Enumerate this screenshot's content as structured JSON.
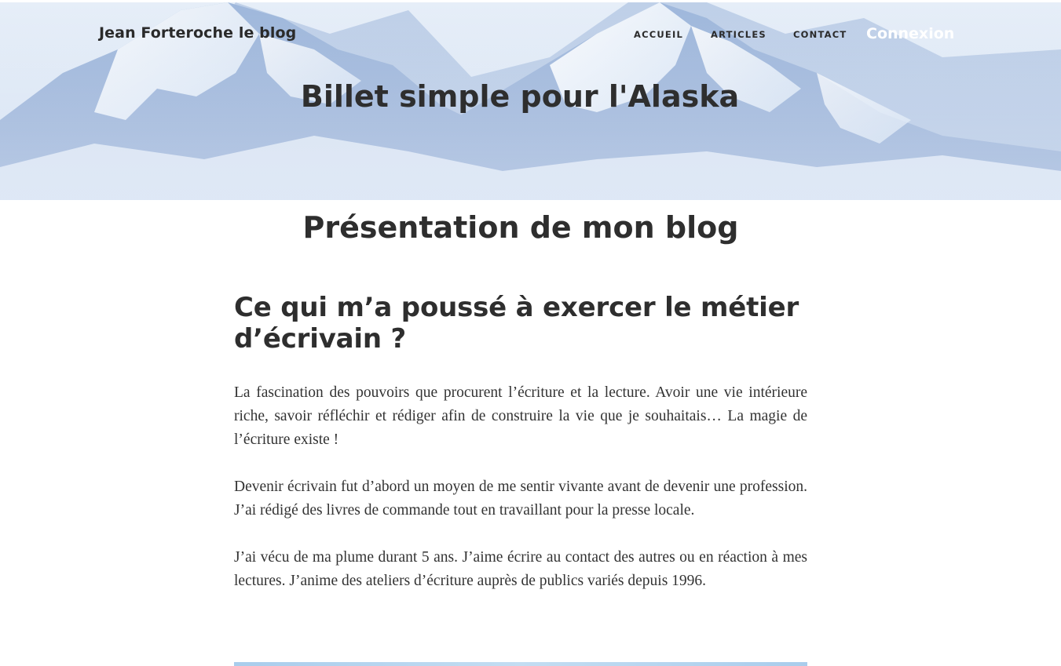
{
  "header": {
    "brand": "Jean Forteroche le blog",
    "nav": [
      {
        "label": "ACCUEIL"
      },
      {
        "label": "ARTICLES"
      },
      {
        "label": "CONTACT"
      }
    ],
    "login_label": "Connexion",
    "site_title": "Billet simple pour l'Alaska",
    "background": "snowy-mountains-image"
  },
  "main": {
    "page_title": "Présentation de mon blog",
    "article": {
      "heading": "Ce qui m’a poussé à exercer le métier d’écrivain ?",
      "paragraphs": [
        "La fascination des pouvoirs que procurent l’écriture et la lecture. Avoir une vie intérieure riche, savoir réfléchir et rédiger afin de construire la vie que je souhaitais… La magie de l’écriture existe !",
        "Devenir écrivain fut d’abord un moyen de me sentir vivante avant de devenir une profession. J’ai rédigé des livres de commande tout en travaillant pour la presse locale.",
        "J’ai vécu de ma plume durant 5 ans. J’aime écrire au contact des autres ou en réaction à mes lectures. J’anime des ateliers d’écriture auprès de publics variés depuis 1996."
      ]
    }
  },
  "colors": {
    "text": "#2e2e2e",
    "login": "#ffffff",
    "divider": "#a9cdec"
  }
}
